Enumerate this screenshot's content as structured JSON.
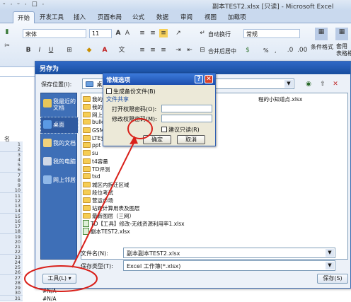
{
  "excel": {
    "quick_access": "ᵕ · ᵕ · ☐ ·",
    "window_title": "副本TEST2.xlsx  [只读] - Microsoft Excel",
    "tabs": [
      "开始",
      "开发工具",
      "插入",
      "页面布局",
      "公式",
      "数据",
      "审阅",
      "视图",
      "加载项"
    ],
    "ribbon": {
      "font_name": "宋体",
      "font_size": "11",
      "wrap_text": "自动换行",
      "number_format": "常规",
      "merge_center": "合并后居中",
      "conditional_format": "条件格式",
      "table_format": "套用\n表格格式",
      "percent": "%",
      "comma": ","
    },
    "column_header_partial": "名",
    "rows": [
      "1",
      "2",
      "3",
      "4",
      "5",
      "6",
      "7",
      "8",
      "9",
      "10",
      "11",
      "12",
      "13",
      "14",
      "15",
      "16",
      "17",
      "18",
      "19",
      "20",
      "21",
      "22",
      "23",
      "24",
      "25",
      "26",
      "27",
      "28",
      "29",
      "30",
      "31"
    ],
    "cell_values": [
      "#N/A",
      "#N/A"
    ]
  },
  "save_as": {
    "title": "另存为",
    "location_label": "保存位置(I):",
    "location_value": "桌面",
    "nav": [
      "我最近的文档",
      "桌面",
      "我的文档",
      "我的电脑",
      "网上邻居"
    ],
    "files": [
      {
        "kind": "folder",
        "name": "我的"
      },
      {
        "kind": "folder",
        "name": "我的"
      },
      {
        "kind": "folder",
        "name": "网上"
      },
      {
        "kind": "folder",
        "name": "bulk"
      },
      {
        "kind": "folder",
        "name": "GSM金"
      },
      {
        "kind": "folder",
        "name": "LTE资"
      },
      {
        "kind": "folder",
        "name": "ppt"
      },
      {
        "kind": "folder",
        "name": "su"
      },
      {
        "kind": "folder",
        "name": "t4容量"
      },
      {
        "kind": "folder",
        "name": "TD评测"
      },
      {
        "kind": "folder",
        "name": "tsd"
      },
      {
        "kind": "folder",
        "name": "城区内拆迁区域"
      },
      {
        "kind": "folder",
        "name": "段位考试"
      },
      {
        "kind": "folder",
        "name": "营运市场"
      },
      {
        "kind": "folder",
        "name": "站距计算用表及图层"
      },
      {
        "kind": "folder",
        "name": "最新图层（三网）"
      },
      {
        "kind": "file",
        "name": "TD【工具】修改-无线资源利用率1.xlsx"
      },
      {
        "kind": "file",
        "name": "副本TEST2.xlsx"
      }
    ],
    "partial_file_right": "程的小知道点.xlsx",
    "filename_label": "文件名(N):",
    "filename_value": "副本副本TEST2.xlsx",
    "filetype_label": "保存类型(T):",
    "filetype_value": "Excel 工作簿(*.xlsx)",
    "tools_button": "工具(L)",
    "save_button": "保存(S)"
  },
  "general_options": {
    "title": "常规选项",
    "help": "?",
    "close": "✕",
    "backup_label": "生成备份文件(B)",
    "section_label": "文件共享",
    "open_pw_label": "打开权限密码(O):",
    "modify_pw_label": "修改权限密码(M):",
    "readonly_label": "建议只读(R)",
    "ok_button": "确定",
    "cancel_button": "取消"
  },
  "colors": {
    "annotation_red": "#d9201a",
    "dialog_blue": "#2f68c6"
  }
}
